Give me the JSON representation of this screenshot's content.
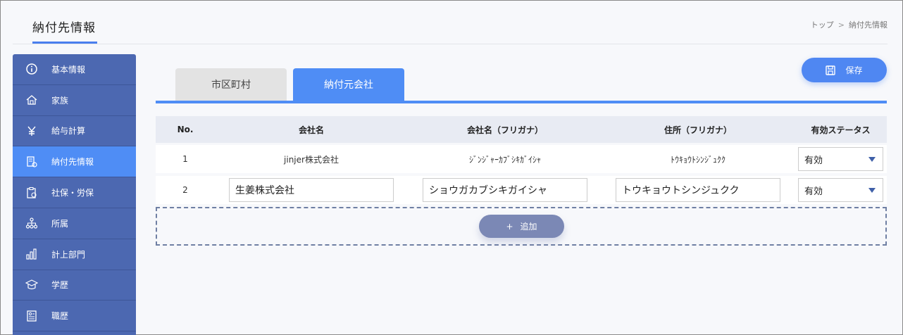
{
  "page": {
    "title": "納付先情報",
    "breadcrumb": {
      "home": "トップ",
      "separator": ">",
      "current": "納付先情報"
    }
  },
  "sidebar": {
    "items": [
      {
        "label": "基本情報",
        "icon": "info-icon",
        "active": false
      },
      {
        "label": "家族",
        "icon": "house-icon",
        "active": false
      },
      {
        "label": "給与計算",
        "icon": "yen-icon",
        "active": false
      },
      {
        "label": "納付先情報",
        "icon": "document-money-icon",
        "active": true
      },
      {
        "label": "社保・労保",
        "icon": "clipboard-icon",
        "active": false
      },
      {
        "label": "所属",
        "icon": "org-chart-icon",
        "active": false
      },
      {
        "label": "計上部門",
        "icon": "bar-chart-icon",
        "active": false
      },
      {
        "label": "学歴",
        "icon": "graduation-cap-icon",
        "active": false
      },
      {
        "label": "職歴",
        "icon": "resume-icon",
        "active": false
      }
    ]
  },
  "toolbar": {
    "save_label": "保存",
    "save_icon": "floppy-disk-icon"
  },
  "tabs": [
    {
      "label": "市区町村",
      "active": false
    },
    {
      "label": "納付元会社",
      "active": true
    }
  ],
  "table": {
    "headers": [
      "No.",
      "会社名",
      "会社名（フリガナ）",
      "住所（フリガナ）",
      "有効ステータス"
    ],
    "rows": [
      {
        "no": "1",
        "company": "jinjer株式会社",
        "company_kana": "ｼﾞﾝｼﾞｬｰｶﾌﾞｼｷｶﾞｲｼｬ",
        "address_kana": "ﾄｳｷｮｳﾄｼﾝｼﾞｭｸｸ",
        "status": "有効"
      },
      {
        "no": "2",
        "company": "生姜株式会社",
        "company_kana": "ショウガカブシキガイシャ",
        "address_kana": "トウキョウトシンジュクク",
        "status": "有効"
      }
    ]
  },
  "add_button": {
    "label": "追加",
    "icon": "plus-icon"
  },
  "colors": {
    "accent": "#4f8df5",
    "sidebar": "#4c68b1",
    "add_button": "#7b88b5"
  }
}
